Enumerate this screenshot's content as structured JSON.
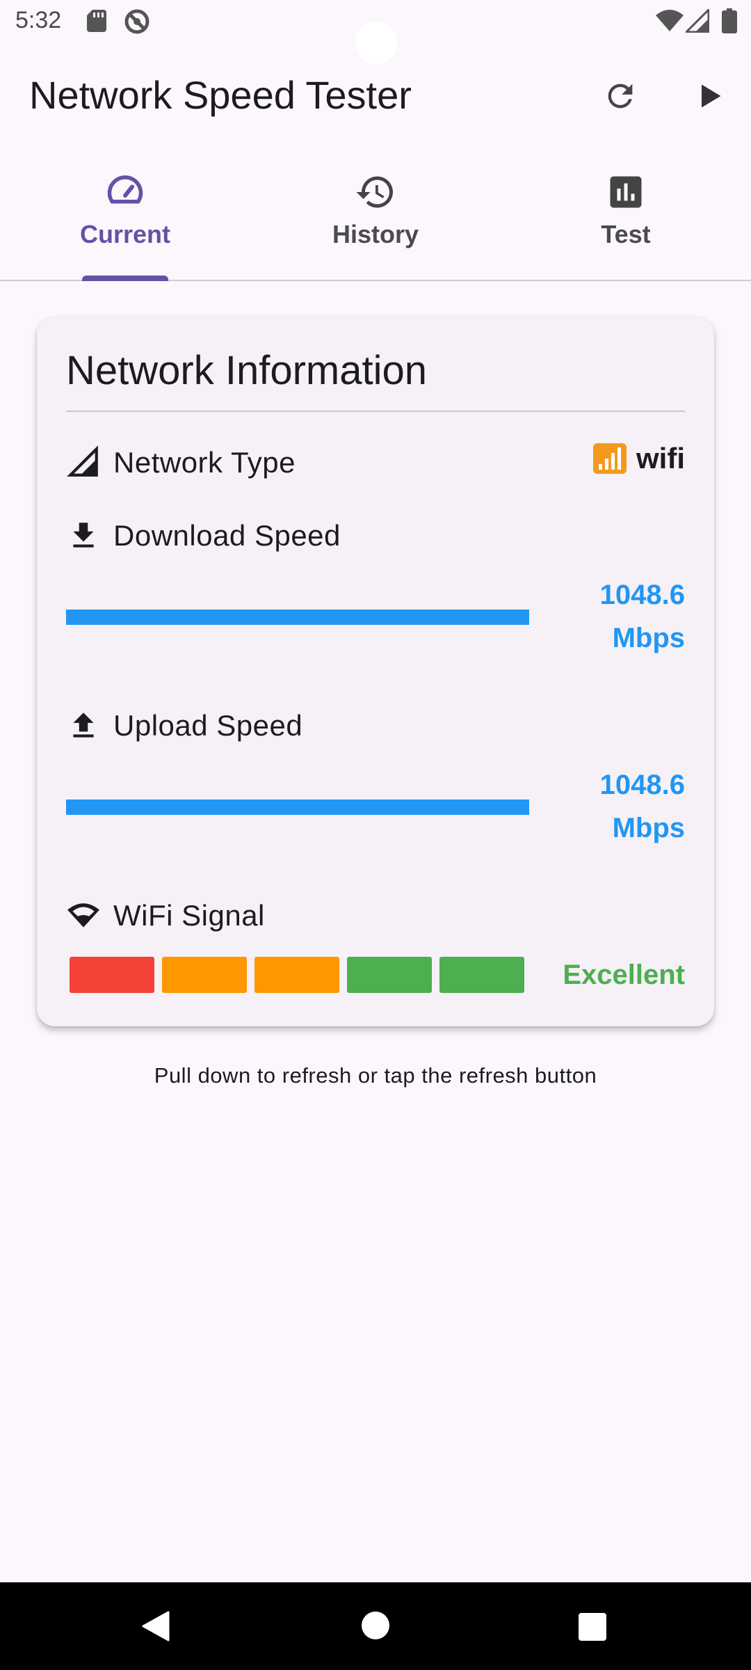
{
  "status_bar": {
    "time": "5:32",
    "icons": [
      "sd-card-icon",
      "do-not-disturb-icon",
      "wifi-icon",
      "cell-signal-icon",
      "battery-icon"
    ]
  },
  "app_bar": {
    "title": "Network Speed Tester",
    "actions": [
      "refresh-icon",
      "play-icon"
    ]
  },
  "tabs": [
    {
      "label": "Current",
      "icon": "speedometer-icon",
      "active": true
    },
    {
      "label": "History",
      "icon": "history-icon",
      "active": false
    },
    {
      "label": "Test",
      "icon": "bar-chart-icon",
      "active": false
    }
  ],
  "card": {
    "title": "Network Information",
    "network_type": {
      "label": "Network Type",
      "icon": "cell-signal-icon",
      "value": "wifi",
      "value_icon": "signal-bars-emoji"
    },
    "download": {
      "label": "Download Speed",
      "icon": "download-icon",
      "value": "1048.6",
      "unit": "Mbps",
      "level": 1.0
    },
    "upload": {
      "label": "Upload Speed",
      "icon": "upload-icon",
      "value": "1048.6",
      "unit": "Mbps",
      "level": 1.0
    },
    "wifi_signal": {
      "label": "WiFi Signal",
      "icon": "wifi-icon",
      "status": "Excellent",
      "segments": [
        "#F44336",
        "#FF9800",
        "#FF9800",
        "#4CAF50",
        "#4CAF50"
      ]
    }
  },
  "hint": "Pull down to refresh or tap the refresh button",
  "colors": {
    "accent": "#6750A4",
    "speed": "#2196F3",
    "excellent": "#4CAF50"
  }
}
